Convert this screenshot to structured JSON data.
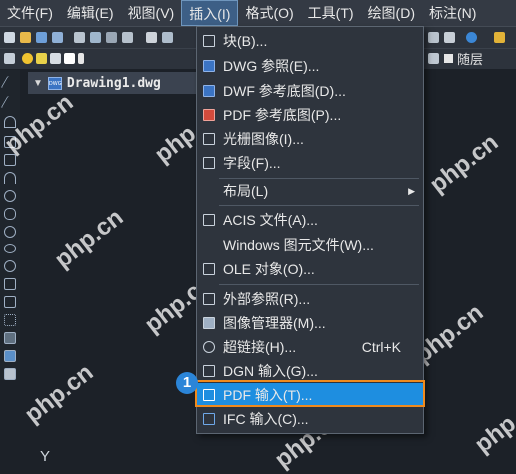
{
  "menubar": {
    "items": [
      "文件(F)",
      "编辑(E)",
      "视图(V)",
      "插入(I)",
      "格式(O)",
      "工具(T)",
      "绘图(D)",
      "标注(N)"
    ]
  },
  "document_tab": {
    "name": "Drawing1.dwg",
    "icon_text": "DWG"
  },
  "toolbar_right": {
    "layer_label": "随层"
  },
  "insert_menu": {
    "items": [
      {
        "label": "块(B)...",
        "icon": "block-icon"
      },
      {
        "label": "DWG 参照(E)...",
        "icon": "dwg-reference-icon"
      },
      {
        "label": "DWF 参考底图(D)...",
        "icon": "dwf-underlay-icon"
      },
      {
        "label": "PDF 参考底图(P)...",
        "icon": "pdf-underlay-icon"
      },
      {
        "label": "光栅图像(I)...",
        "icon": "raster-image-icon"
      },
      {
        "label": "字段(F)...",
        "icon": "field-icon"
      },
      {
        "label": "布局(L)",
        "icon": ""
      },
      {
        "label": "ACIS 文件(A)...",
        "icon": "acis-file-icon"
      },
      {
        "label": "Windows 图元文件(W)...",
        "icon": ""
      },
      {
        "label": "OLE 对象(O)...",
        "icon": "ole-object-icon"
      },
      {
        "label": "外部参照(R)...",
        "icon": "xref-icon"
      },
      {
        "label": "图像管理器(M)...",
        "icon": "image-manager-icon"
      },
      {
        "label": "超链接(H)...",
        "icon": "hyperlink-icon",
        "shortcut": "Ctrl+K"
      },
      {
        "label": "DGN 输入(G)...",
        "icon": "dgn-import-icon"
      },
      {
        "label": "PDF 输入(T)...",
        "icon": "pdf-import-icon"
      },
      {
        "label": "IFC 输入(C)...",
        "icon": "ifc-import-icon"
      }
    ]
  },
  "callout": {
    "number": "1"
  },
  "canvas": {
    "axis_label": "Y"
  },
  "watermark": "php.cn",
  "colors": {
    "highlight": "#1e8ee0",
    "callout_border": "#f08a1c",
    "badge": "#2b85d8"
  }
}
